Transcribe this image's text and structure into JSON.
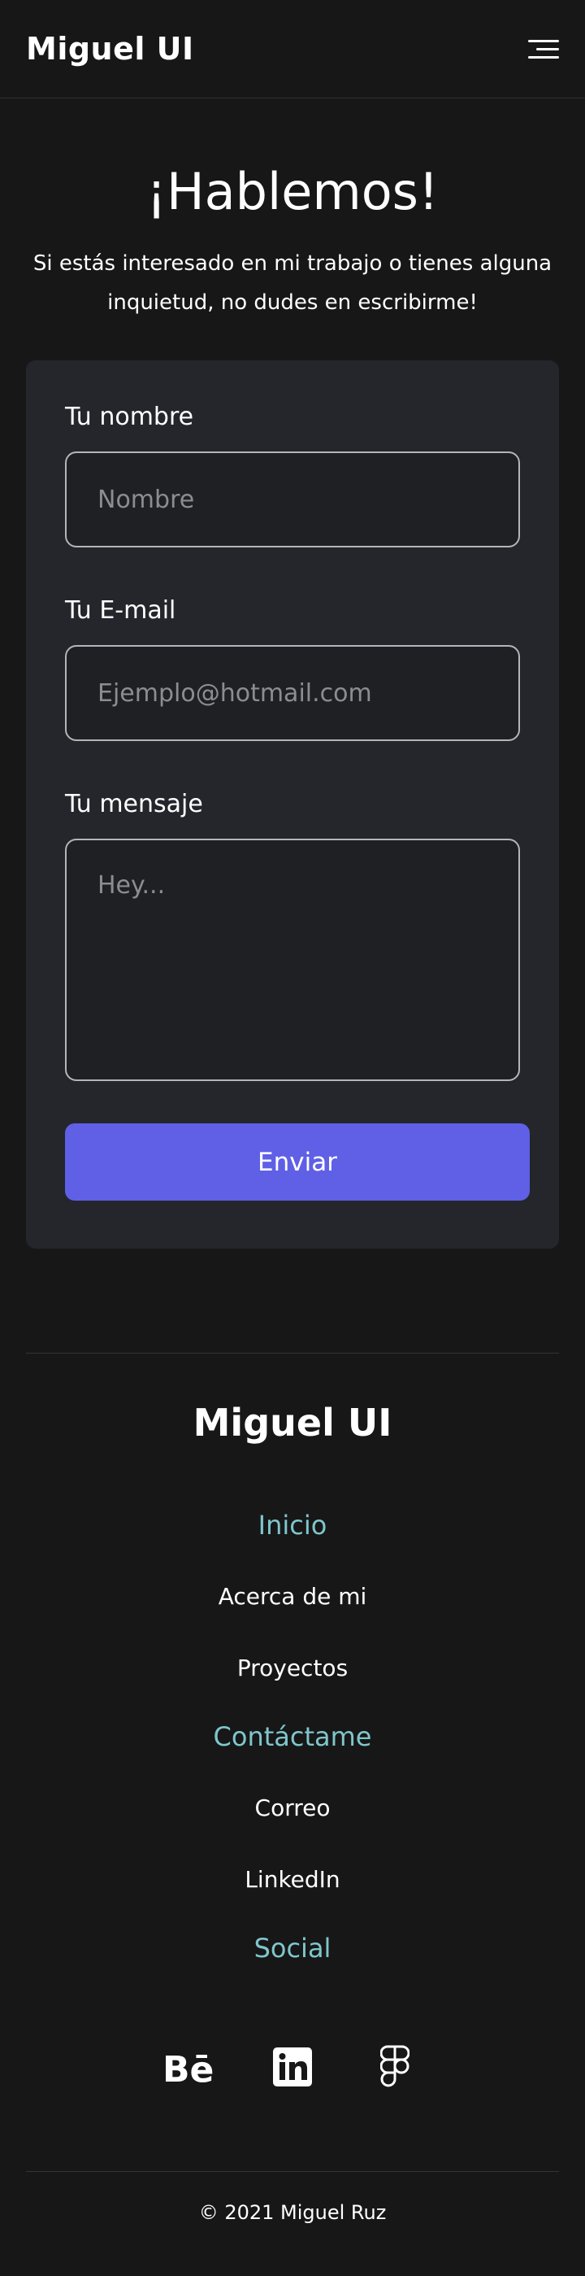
{
  "nav": {
    "brand": "Miguel UI"
  },
  "hero": {
    "title": "¡Hablemos!",
    "subtitle": "Si estás interesado en mi trabajo o tienes alguna inquietud, no dudes en escribirme!"
  },
  "form": {
    "name_label": "Tu nombre",
    "name_placeholder": "Nombre",
    "email_label": "Tu E-mail",
    "email_placeholder": "Ejemplo@hotmail.com",
    "message_label": "Tu mensaje",
    "message_placeholder": "Hey...",
    "submit_label": "Enviar"
  },
  "footer": {
    "brand": "Miguel UI",
    "sections": [
      {
        "heading": "Inicio",
        "links": [
          "Acerca de mi",
          "Proyectos"
        ]
      },
      {
        "heading": "Contáctame",
        "links": [
          "Correo",
          "LinkedIn"
        ]
      },
      {
        "heading": "Social"
      }
    ],
    "social_icons": [
      "behance-icon",
      "linkedin-icon",
      "figma-icon"
    ],
    "copyright": "© 2021 Miguel Ruz"
  },
  "colors": {
    "background": "#171717",
    "card": "#24262b",
    "accent": "#5f60e6",
    "heading_accent": "#7fc6cc"
  }
}
